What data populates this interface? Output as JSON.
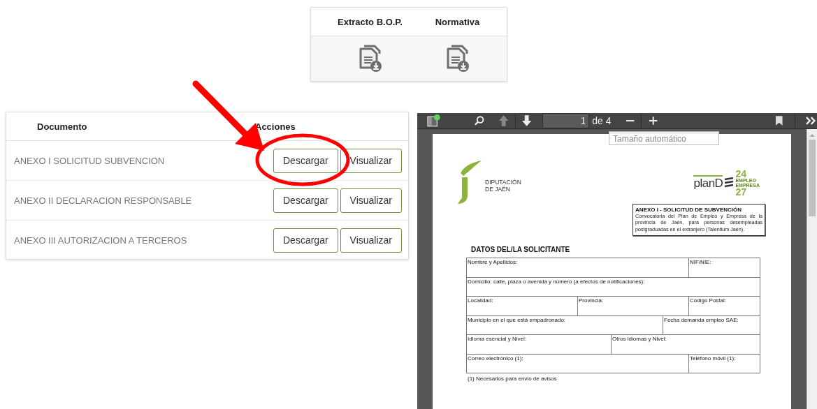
{
  "documents_card": {
    "columns": [
      "Extracto B.O.P.",
      "Normativa"
    ]
  },
  "annex_table": {
    "columns": [
      "Documento",
      "Acciones"
    ],
    "rows": [
      {
        "name": "ANEXO I SOLICITUD SUBVENCION",
        "buttons": [
          "Descargar",
          "Visualizar"
        ]
      },
      {
        "name": "ANEXO II DECLARACION RESPONSABLE",
        "buttons": [
          "Descargar",
          "Visualizar"
        ]
      },
      {
        "name": "ANEXO III AUTORIZACION A TERCEROS",
        "buttons": [
          "Descargar",
          "Visualizar"
        ]
      }
    ]
  },
  "pdf_viewer": {
    "toolbar": {
      "sidebar_notification": true,
      "previous_disabled": true,
      "page_input": "1",
      "page_count": "de 4",
      "zoom_select": "Tamaño automático"
    },
    "page": {
      "logo_left": [
        "DIPUTACIÓN",
        "DE JAÉN"
      ],
      "logo_right": {
        "plan": "planD",
        "years": [
          "24",
          "27"
        ],
        "tagline": [
          "EMPLEO",
          "EMPRESA"
        ]
      },
      "annex_title": "ANEXO I -  SOLICITUD DE SUBVENCIÓN",
      "annex_text": "Convocatoria del Plan de Empleo y Empresa de la provincia de Jaén, para personas desempleadas postgraduadas en el extranjero (Talentium Jaén).",
      "section_title": "DATOS DEL/LA SOLICITANTE",
      "form_rows": [
        [
          "Nombre y Apellidos:",
          "NIF/NIE:"
        ],
        [
          "Domicilio: calle, plaza o avenida y número (a efectos de notificaciones):"
        ],
        [
          "Localidad:",
          "Provincia:",
          "Código Postal:"
        ],
        [
          "Municipio en el que está empadronado:",
          "Fecha demanda empleo SAE:"
        ],
        [
          "Idioma esencial y Nivel:",
          "Otros idiomas y Nivel:"
        ],
        [
          "Correo electrónico (1):",
          "Teléfono móvil (1):"
        ]
      ],
      "footnote": "(1) Necesarios para envio de avisos"
    }
  }
}
